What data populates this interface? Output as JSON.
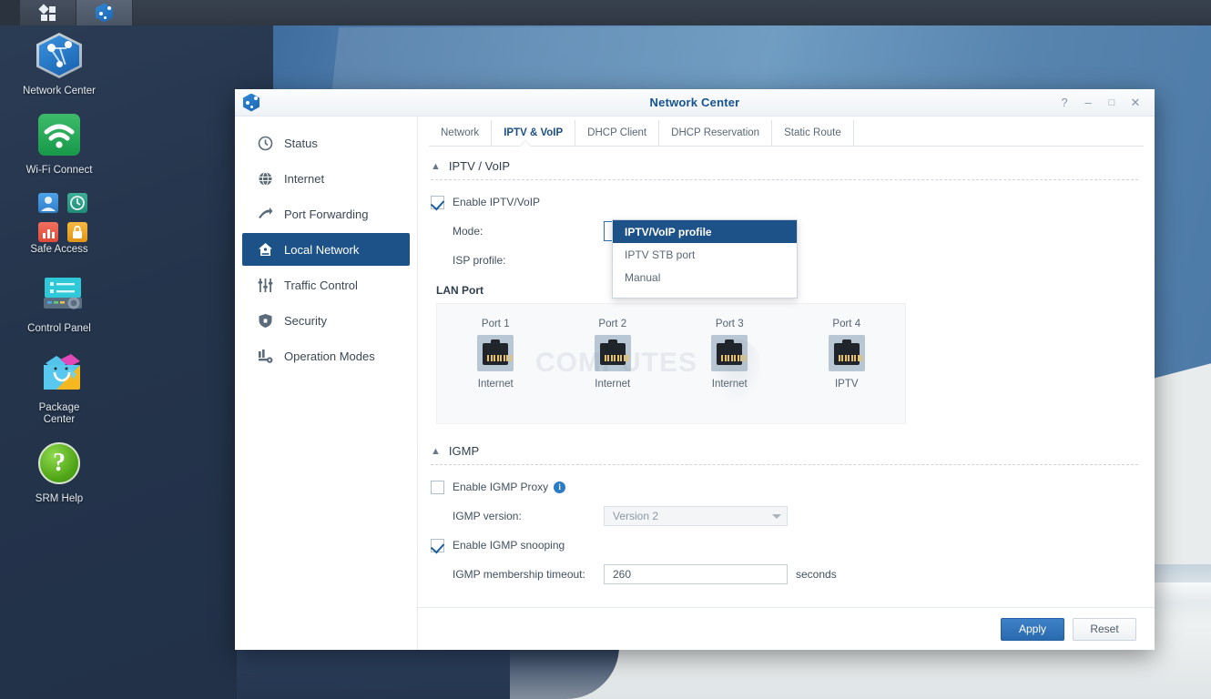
{
  "taskbar": {
    "buttons": [
      {
        "name": "tiles-icon",
        "label": ""
      },
      {
        "name": "network-center-icon",
        "label": ""
      }
    ]
  },
  "desktop_icons": [
    {
      "icon": "network-center-icon",
      "label": "Network Center"
    },
    {
      "icon": "wifi-connect-icon",
      "label": "Wi-Fi Connect"
    },
    {
      "icon": "safe-access-icon",
      "label": "Safe Access"
    },
    {
      "icon": "control-panel-icon",
      "label": "Control Panel"
    },
    {
      "icon": "package-center-icon",
      "label": "Package\nCenter"
    },
    {
      "icon": "srm-help-icon",
      "label": "SRM Help"
    }
  ],
  "desktop_icon_labels": {
    "network_center": "Network Center",
    "wifi_connect": "Wi-Fi Connect",
    "safe_access": "Safe Access",
    "control_panel": "Control Panel",
    "package_center_line1": "Package",
    "package_center_line2": "Center",
    "srm_help": "SRM Help"
  },
  "window": {
    "title": "Network Center",
    "controls": {
      "help": "?",
      "minimize": "–",
      "maximize": "□",
      "close": "✕"
    }
  },
  "sidebar": {
    "items": [
      {
        "label": "Status",
        "icon": "clock-icon",
        "active": false
      },
      {
        "label": "Internet",
        "icon": "globe-icon",
        "active": false
      },
      {
        "label": "Port Forwarding",
        "icon": "arrow-icon",
        "active": false
      },
      {
        "label": "Local Network",
        "icon": "home-icon",
        "active": true
      },
      {
        "label": "Traffic Control",
        "icon": "sliders-icon",
        "active": false
      },
      {
        "label": "Security",
        "icon": "shield-icon",
        "active": false
      },
      {
        "label": "Operation Modes",
        "icon": "operation-modes-icon",
        "active": false
      }
    ]
  },
  "tabs": [
    {
      "label": "Network",
      "active": false
    },
    {
      "label": "IPTV & VoIP",
      "active": true
    },
    {
      "label": "DHCP Client",
      "active": false
    },
    {
      "label": "DHCP Reservation",
      "active": false
    },
    {
      "label": "Static Route",
      "active": false
    }
  ],
  "iptv_section": {
    "heading": "IPTV / VoIP",
    "enable_label": "Enable IPTV/VoIP",
    "enable_checked": true,
    "mode_label": "Mode:",
    "mode_value": "IPTV/VoIP profile",
    "mode_options": [
      "IPTV/VoIP profile",
      "IPTV STB port",
      "Manual"
    ],
    "mode_selected_index": 0,
    "isp_profile_label": "ISP profile:"
  },
  "lan_port": {
    "heading": "LAN Port",
    "ports": [
      {
        "name": "Port 1",
        "state": "Internet"
      },
      {
        "name": "Port 2",
        "state": "Internet"
      },
      {
        "name": "Port 3",
        "state": "Internet"
      },
      {
        "name": "Port 4",
        "state": "IPTV"
      }
    ],
    "watermark": "COMPUTES"
  },
  "igmp_section": {
    "heading": "IGMP",
    "proxy_label": "Enable IGMP Proxy",
    "proxy_checked": false,
    "info_glyph": "i",
    "version_label": "IGMP version:",
    "version_value": "Version 2",
    "snooping_label": "Enable IGMP snooping",
    "snooping_checked": true,
    "timeout_label": "IGMP membership timeout:",
    "timeout_value": "260",
    "timeout_unit": "seconds"
  },
  "footer": {
    "apply_label": "Apply",
    "reset_label": "Reset"
  },
  "colors": {
    "accent_blue": "#1d5288",
    "title_blue": "#15528f",
    "apply_blue": "#2a69ae",
    "desktop_dark": "#24344b",
    "panel_bg": "#f7f9fb"
  }
}
